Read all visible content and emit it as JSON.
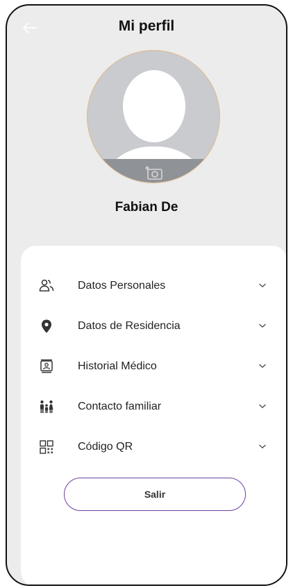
{
  "header": {
    "title": "Mi perfil"
  },
  "profile": {
    "name": "Fabian De"
  },
  "menu": {
    "items": [
      {
        "label": "Datos Personales",
        "icon": "people-icon"
      },
      {
        "label": "Datos de Residencia",
        "icon": "location-pin-icon"
      },
      {
        "label": "Historial Médico",
        "icon": "medical-record-icon"
      },
      {
        "label": "Contacto familiar",
        "icon": "family-icon"
      },
      {
        "label": "Código QR",
        "icon": "qr-code-icon"
      }
    ]
  },
  "logout": {
    "label": "Salir"
  },
  "colors": {
    "background": "#ececec",
    "card": "#ffffff",
    "accent": "#6b3fa0",
    "avatar_bg": "#c9cbcf"
  }
}
